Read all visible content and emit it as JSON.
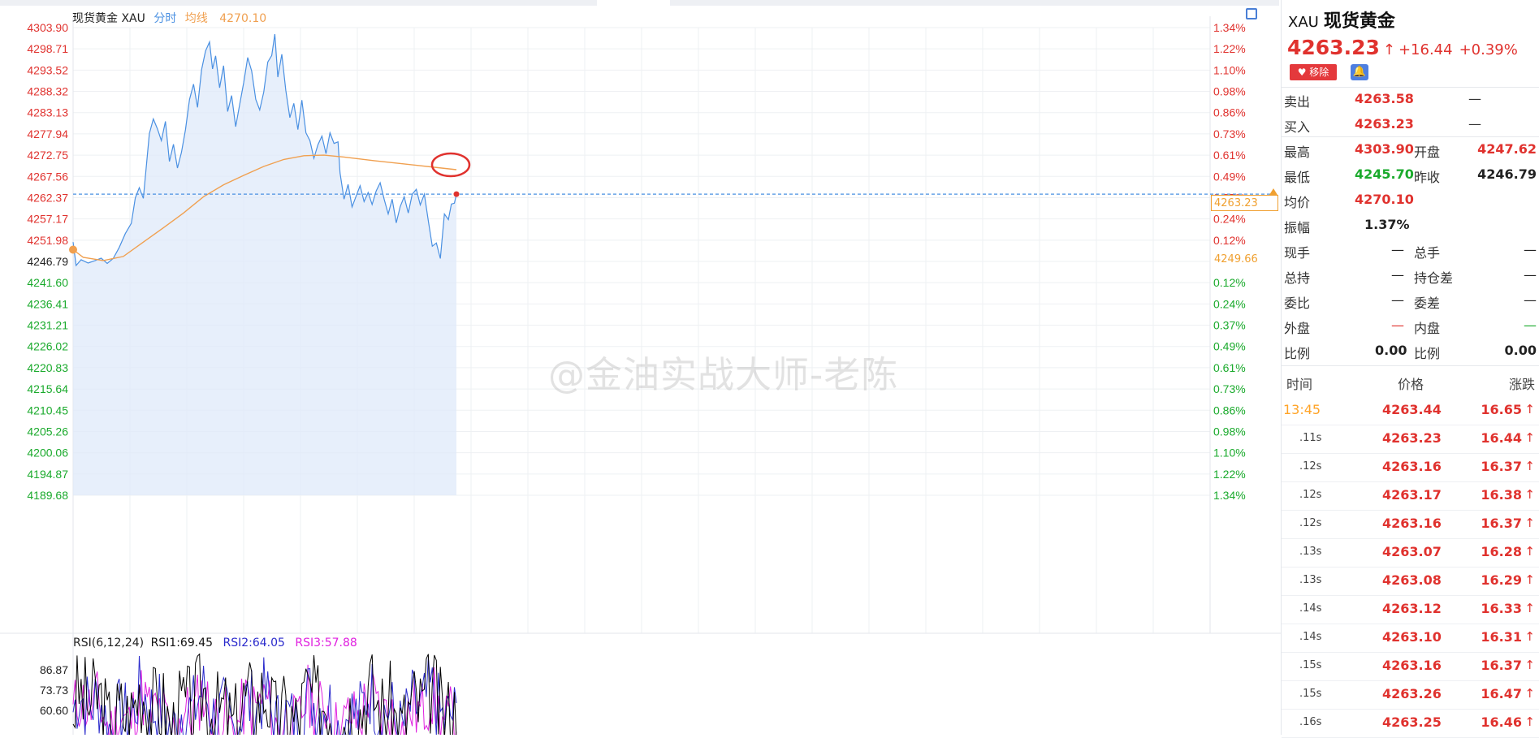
{
  "legend": {
    "name": "现货黄金 XAU",
    "mode": "分时",
    "avg_label": "均线",
    "avg_value": "4270.10"
  },
  "left_axis": [
    "4303.90",
    "4298.71",
    "4293.52",
    "4288.32",
    "4283.13",
    "4277.94",
    "4272.75",
    "4267.56",
    "4262.37",
    "4257.17",
    "4251.98",
    "4246.79",
    "4241.60",
    "4236.41",
    "4231.21",
    "4226.02",
    "4220.83",
    "4215.64",
    "4210.45",
    "4205.26",
    "4200.06",
    "4194.87",
    "4189.68"
  ],
  "right_axis": [
    "1.34%",
    "1.22%",
    "1.10%",
    "0.98%",
    "0.86%",
    "0.73%",
    "0.61%",
    "0.49%",
    "0.37%",
    "0.24%",
    "0.12%",
    "",
    "0.12%",
    "0.24%",
    "0.37%",
    "0.49%",
    "0.61%",
    "0.73%",
    "0.86%",
    "0.98%",
    "1.10%",
    "1.22%",
    "1.34%"
  ],
  "last_price_label": "4263.23",
  "prev_close_label": "4249.66",
  "rsi": {
    "title": "RSI(6,12,24)",
    "rsi1": "RSI1:69.45",
    "rsi2": "RSI2:64.05",
    "rsi3": "RSI3:57.88",
    "axis": [
      "86.87",
      "73.73",
      "60.60"
    ]
  },
  "watermark": "@金油实战大师-老陈",
  "colors": {
    "up": "#e0322e",
    "down": "#1aaa2c",
    "price_line": "#4a90e2",
    "avg_line": "#f0a050",
    "rsi1": "#000000",
    "rsi2": "#2a2acc",
    "rsi3": "#e020e0"
  },
  "panel": {
    "symbol": "XAU",
    "name": "现货黄金",
    "price": "4263.23",
    "arrow": "↑",
    "change": "+16.44",
    "change_pct": "+0.39%",
    "remove_btn": "♥ 移除",
    "bell_icon": "bell-icon",
    "ask_label": "卖出",
    "ask": "4263.58",
    "ask_dash": "—",
    "bid_label": "买入",
    "bid": "4263.23",
    "bid_dash": "—",
    "high_label": "最高",
    "high": "4303.90",
    "open_label": "开盘",
    "open": "4247.62",
    "low_label": "最低",
    "low": "4245.70",
    "prev_label": "昨收",
    "prev": "4246.79",
    "avg_label": "均价",
    "avg": "4270.10",
    "amp_label": "振幅",
    "amp": "1.37%",
    "r1l": "现手",
    "r1v": "—",
    "r1l2": "总手",
    "r1v2": "—",
    "r2l": "总持",
    "r2v": "—",
    "r2l2": "持仓差",
    "r2v2": "—",
    "r3l": "委比",
    "r3v": "—",
    "r3l2": "委差",
    "r3v2": "—",
    "r4l": "外盘",
    "r4v": "—",
    "r4l2": "内盘",
    "r4v2": "—",
    "r5l": "比例",
    "r5v": "0.00",
    "r5l2": "比例",
    "r5v2": "0.00",
    "th_time": "时间",
    "th_price": "价格",
    "th_change": "涨跌",
    "ticks": [
      {
        "t": "13:45",
        "p": "4263.44",
        "c": "16.65"
      },
      {
        "t": ".11s",
        "p": "4263.23",
        "c": "16.44"
      },
      {
        "t": ".12s",
        "p": "4263.16",
        "c": "16.37"
      },
      {
        "t": ".12s",
        "p": "4263.17",
        "c": "16.38"
      },
      {
        "t": ".12s",
        "p": "4263.16",
        "c": "16.37"
      },
      {
        "t": ".13s",
        "p": "4263.07",
        "c": "16.28"
      },
      {
        "t": ".13s",
        "p": "4263.08",
        "c": "16.29"
      },
      {
        "t": ".14s",
        "p": "4263.12",
        "c": "16.33"
      },
      {
        "t": ".14s",
        "p": "4263.10",
        "c": "16.31"
      },
      {
        "t": ".15s",
        "p": "4263.16",
        "c": "16.37"
      },
      {
        "t": ".15s",
        "p": "4263.26",
        "c": "16.47"
      },
      {
        "t": ".16s",
        "p": "4263.25",
        "c": "16.46"
      }
    ],
    "tick_arrow": "🡑"
  },
  "chart_data": {
    "type": "line",
    "title": "现货黄金 XAU 分时",
    "prev_close": 4246.79,
    "ylim": [
      4189.68,
      4303.9
    ],
    "last": 4263.23,
    "avg": 4270.1,
    "price_keypoints": [
      [
        0,
        4251.5
      ],
      [
        3,
        4245.8
      ],
      [
        8,
        4247.2
      ],
      [
        15,
        4246.4
      ],
      [
        22,
        4247.0
      ],
      [
        28,
        4247.6
      ],
      [
        34,
        4246.3
      ],
      [
        40,
        4247.5
      ],
      [
        46,
        4250.2
      ],
      [
        52,
        4253.6
      ],
      [
        58,
        4256.1
      ],
      [
        62,
        4262.3
      ],
      [
        66,
        4264.8
      ],
      [
        70,
        4262.2
      ],
      [
        76,
        4278.0
      ],
      [
        80,
        4281.6
      ],
      [
        84,
        4279.2
      ],
      [
        88,
        4276.3
      ],
      [
        92,
        4281.0
      ],
      [
        96,
        4271.2
      ],
      [
        100,
        4275.4
      ],
      [
        104,
        4269.6
      ],
      [
        108,
        4273.4
      ],
      [
        112,
        4279.0
      ],
      [
        116,
        4286.3
      ],
      [
        120,
        4290.1
      ],
      [
        124,
        4284.4
      ],
      [
        128,
        4293.6
      ],
      [
        132,
        4298.2
      ],
      [
        136,
        4300.4
      ],
      [
        139,
        4293.8
      ],
      [
        142,
        4297.0
      ],
      [
        146,
        4289.2
      ],
      [
        150,
        4294.6
      ],
      [
        154,
        4283.4
      ],
      [
        158,
        4287.3
      ],
      [
        162,
        4279.7
      ],
      [
        166,
        4285.1
      ],
      [
        170,
        4290.5
      ],
      [
        174,
        4296.6
      ],
      [
        178,
        4293.3
      ],
      [
        182,
        4286.4
      ],
      [
        186,
        4283.8
      ],
      [
        190,
        4288.2
      ],
      [
        194,
        4295.5
      ],
      [
        198,
        4297.1
      ],
      [
        201,
        4302.3
      ],
      [
        204,
        4291.8
      ],
      [
        208,
        4297.4
      ],
      [
        212,
        4288.6
      ],
      [
        216,
        4281.9
      ],
      [
        220,
        4285.4
      ],
      [
        224,
        4279.0
      ],
      [
        228,
        4286.2
      ],
      [
        232,
        4278.2
      ],
      [
        236,
        4276.3
      ],
      [
        240,
        4272.0
      ],
      [
        244,
        4275.3
      ],
      [
        248,
        4277.4
      ],
      [
        252,
        4273.1
      ],
      [
        256,
        4278.2
      ],
      [
        260,
        4275.6
      ],
      [
        264,
        4276.0
      ],
      [
        266,
        4268.4
      ],
      [
        270,
        4262.0
      ],
      [
        274,
        4265.6
      ],
      [
        278,
        4260.1
      ],
      [
        282,
        4262.7
      ],
      [
        286,
        4265.3
      ],
      [
        290,
        4261.4
      ],
      [
        294,
        4263.6
      ],
      [
        298,
        4260.7
      ],
      [
        302,
        4264.0
      ],
      [
        306,
        4266.0
      ],
      [
        310,
        4262.0
      ],
      [
        314,
        4258.4
      ],
      [
        318,
        4262.0
      ],
      [
        322,
        4256.2
      ],
      [
        326,
        4260.2
      ],
      [
        330,
        4262.6
      ],
      [
        334,
        4258.6
      ],
      [
        338,
        4263.2
      ],
      [
        342,
        4264.4
      ],
      [
        346,
        4260.6
      ],
      [
        350,
        4263.2
      ],
      [
        354,
        4256.7
      ],
      [
        358,
        4250.5
      ],
      [
        362,
        4251.3
      ],
      [
        366,
        4247.5
      ],
      [
        370,
        4258.4
      ],
      [
        374,
        4257.0
      ],
      [
        377,
        4260.8
      ],
      [
        380,
        4261.0
      ],
      [
        382,
        4263.23
      ]
    ],
    "avg_keypoints": [
      [
        0,
        4249.66
      ],
      [
        10,
        4247.8
      ],
      [
        30,
        4247.0
      ],
      [
        50,
        4248.0
      ],
      [
        70,
        4251.5
      ],
      [
        90,
        4255.0
      ],
      [
        110,
        4258.6
      ],
      [
        130,
        4262.6
      ],
      [
        150,
        4265.5
      ],
      [
        170,
        4267.8
      ],
      [
        190,
        4270.0
      ],
      [
        210,
        4271.7
      ],
      [
        230,
        4272.6
      ],
      [
        250,
        4272.75
      ],
      [
        270,
        4272.3
      ],
      [
        300,
        4271.4
      ],
      [
        330,
        4270.6
      ],
      [
        360,
        4269.8
      ],
      [
        382,
        4269.2
      ]
    ],
    "rsi_ylim": [
      45,
      100
    ]
  }
}
